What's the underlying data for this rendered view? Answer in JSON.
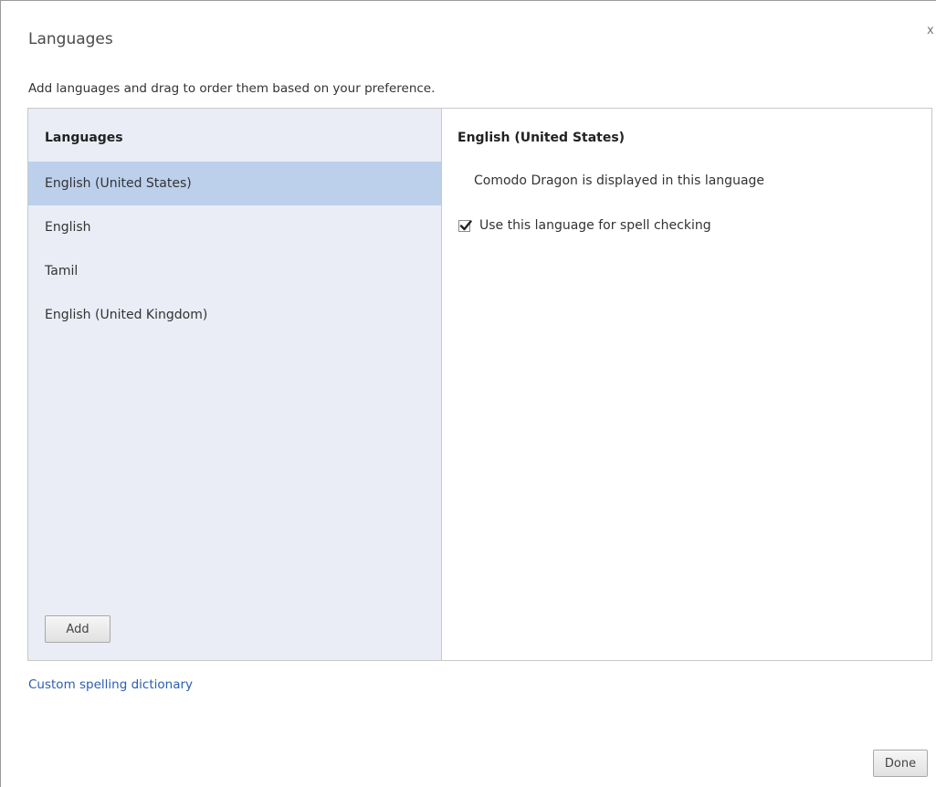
{
  "dialog": {
    "title": "Languages",
    "close_glyph": "x",
    "instructions": "Add languages and drag to order them based on your preference."
  },
  "languages_pane": {
    "header": "Languages",
    "items": [
      {
        "label": "English (United States)",
        "selected": true
      },
      {
        "label": "English",
        "selected": false
      },
      {
        "label": "Tamil",
        "selected": false
      },
      {
        "label": "English (United Kingdom)",
        "selected": false
      }
    ],
    "add_label": "Add"
  },
  "details_pane": {
    "title": "English (United States)",
    "display_note": "Comodo Dragon is displayed in this language",
    "spell_check_label": "Use this language for spell checking",
    "spell_check_checked": true
  },
  "footer": {
    "custom_dictionary_link": "Custom spelling dictionary",
    "done_label": "Done"
  },
  "colors": {
    "list_background": "#eaedf6",
    "selected_item": "#bcd0ec",
    "link": "#2a5db0"
  }
}
